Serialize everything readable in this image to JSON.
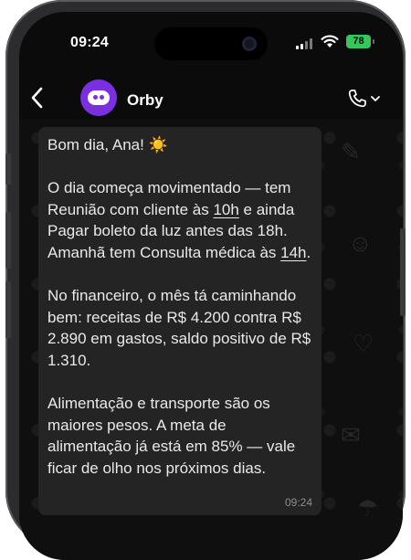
{
  "status_bar": {
    "time": "09:24",
    "battery": "78"
  },
  "header": {
    "contact_name": "Orby"
  },
  "message": {
    "greeting": "Bom dia, Ana!",
    "greeting_emoji": "☀️",
    "p2_a": "O dia começa movimentado — tem Reunião com cliente às ",
    "p2_u1": "10h",
    "p2_b": " e ainda Pagar boleto da luz antes das 18h. Amanhã tem Consulta médica às ",
    "p2_u2": "14h",
    "p2_c": ".",
    "p3": "No financeiro, o mês tá caminhando bem: receitas de R$ 4.200 contra R$ 2.890 em gastos, saldo positivo de R$ 1.310.",
    "p4": "Alimentação e transporte são os maiores pesos. A meta de alimentação já está em 85% — vale ficar de olho nos próximos dias.",
    "time": "09:24"
  },
  "icons": {
    "back": "chevron-left-icon",
    "call": "phone-icon",
    "call_menu": "chevron-down-icon",
    "signal": "cellular-signal-icon",
    "wifi": "wifi-icon",
    "avatar": "bot-avatar-icon"
  },
  "colors": {
    "avatar": "#7a2fe0",
    "battery": "#35c759",
    "bubble": "#242424",
    "background": "#0b0b0b"
  }
}
